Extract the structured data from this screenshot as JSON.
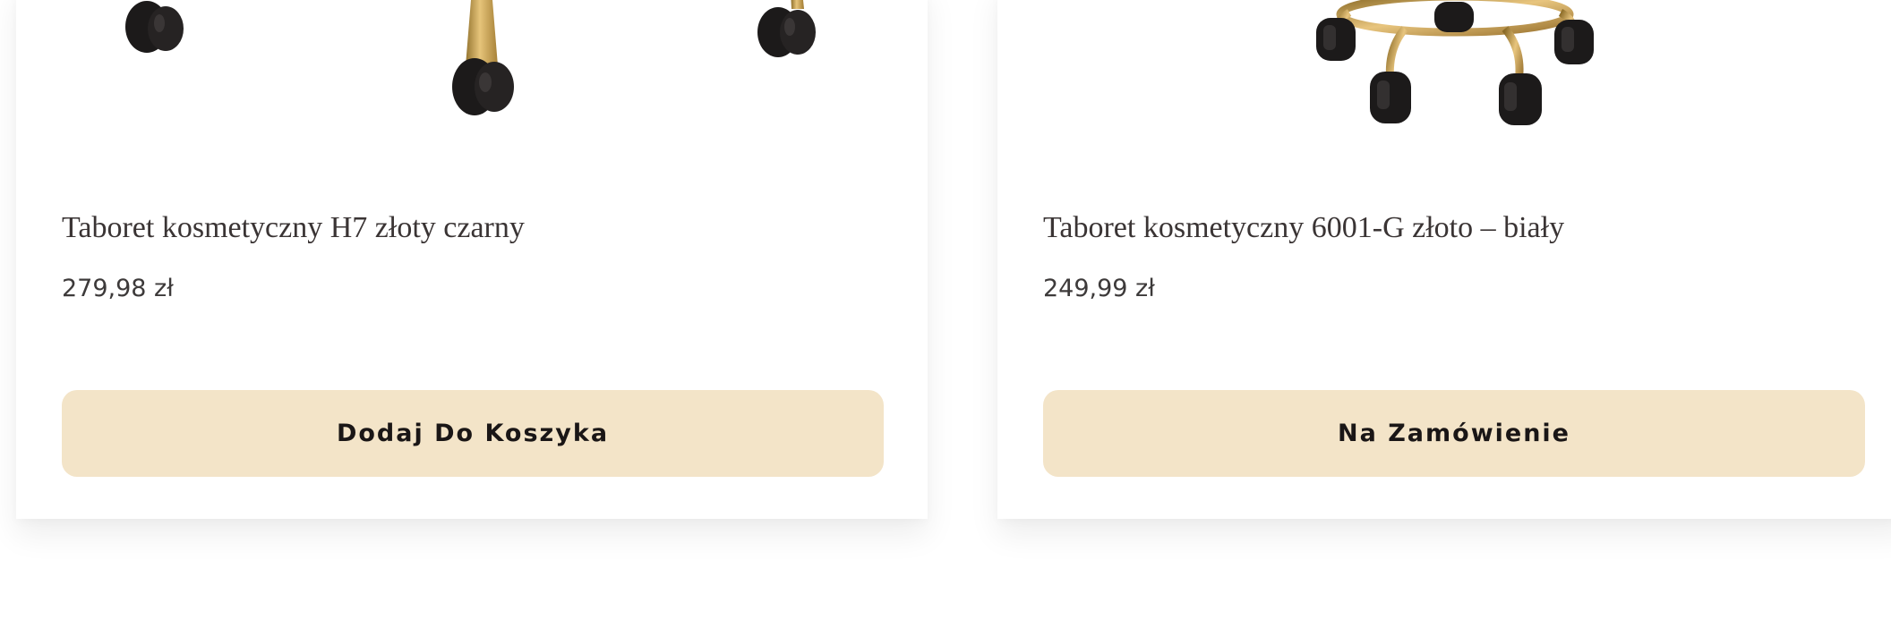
{
  "colors": {
    "button_bg": "#f3e4c8",
    "title_text": "#3a3434",
    "price_text": "#3d3a3a",
    "button_text": "#1a1616",
    "gold": "#c9a24a",
    "caster_black": "#1c1a1a"
  },
  "products": [
    {
      "image": "black-gold-stool-base-image",
      "title": "Taboret kosmetyczny H7 złoty czarny",
      "price": "279,98 zł",
      "button_label": "Dodaj Do Koszyka"
    },
    {
      "image": "gold-stool-base-with-casters-image",
      "title": "Taboret kosmetyczny 6001-G złoto – biały",
      "price": "249,99 zł",
      "button_label": "Na Zamówienie"
    }
  ]
}
